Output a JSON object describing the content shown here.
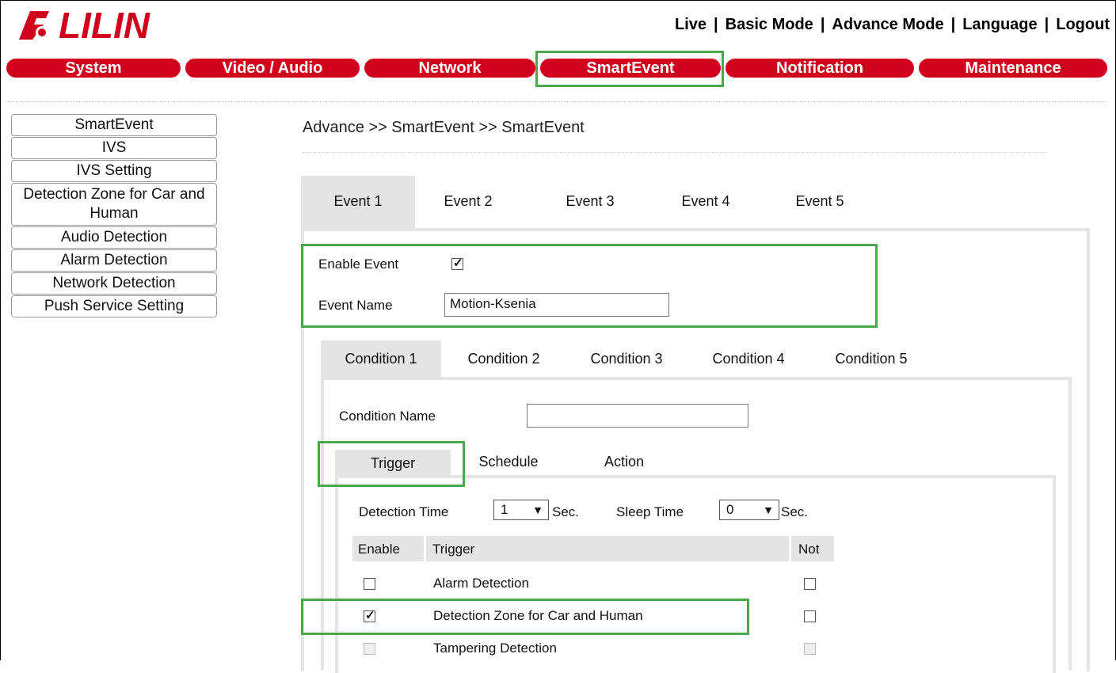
{
  "brand": {
    "logo_text": "LILIN",
    "color": "#d1001c"
  },
  "top_links": [
    "Live",
    "Basic Mode",
    "Advance Mode",
    "Language",
    "Logout"
  ],
  "main_nav": [
    "System",
    "Video / Audio",
    "Network",
    "SmartEvent",
    "Notification",
    "Maintenance"
  ],
  "sidebar": [
    "SmartEvent",
    "IVS",
    "IVS Setting",
    "Detection Zone for Car and Human",
    "Audio Detection",
    "Alarm Detection",
    "Network Detection",
    "Push Service Setting"
  ],
  "breadcrumb": "Advance >> SmartEvent >> SmartEvent",
  "event_tabs": [
    "Event 1",
    "Event 2",
    "Event 3",
    "Event 4",
    "Event 5"
  ],
  "event": {
    "enable_label": "Enable Event",
    "enabled": true,
    "name_label": "Event Name",
    "name_value": "Motion-Ksenia"
  },
  "condition_tabs": [
    "Condition 1",
    "Condition 2",
    "Condition 3",
    "Condition 4",
    "Condition 5"
  ],
  "condition": {
    "name_label": "Condition Name",
    "name_value": ""
  },
  "sub_tabs": [
    "Trigger",
    "Schedule",
    "Action"
  ],
  "trigger": {
    "detection_time_label": "Detection Time",
    "detection_time_value": "1",
    "sleep_time_label": "Sleep Time",
    "sleep_time_value": "0",
    "unit": "Sec.",
    "columns": [
      "Enable",
      "Trigger",
      "Not"
    ],
    "rows": [
      {
        "enable": false,
        "name": "Alarm Detection",
        "not": false,
        "disabled": false
      },
      {
        "enable": true,
        "name": "Detection Zone for Car and Human",
        "not": false,
        "disabled": false
      },
      {
        "enable": false,
        "name": "Tampering Detection",
        "not": false,
        "disabled": true
      }
    ]
  },
  "highlight_color": "#4aa84a"
}
